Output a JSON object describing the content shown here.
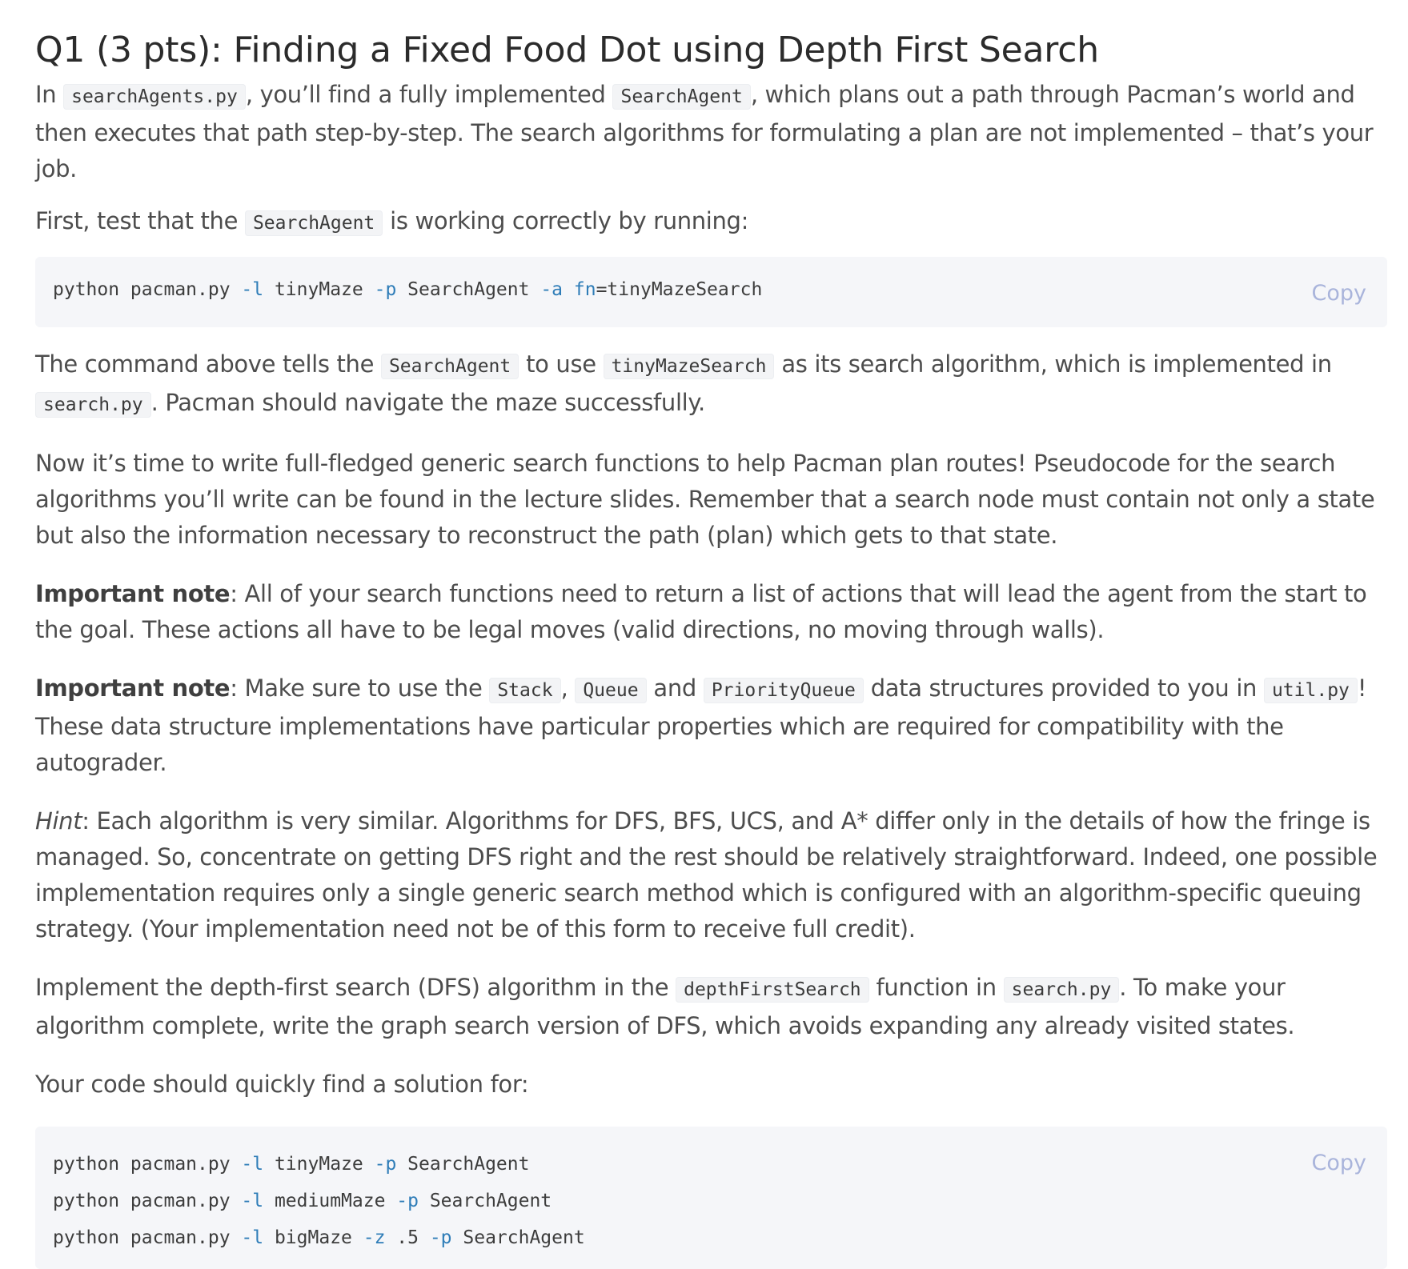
{
  "title": "Q1 (3 pts): Finding a Fixed Food Dot using Depth First Search",
  "p1": {
    "t1": "In ",
    "c1": "searchAgents.py",
    "t2": ", you’ll find a fully implemented ",
    "c2": "SearchAgent",
    "t3": ", which plans out a path through Pacman’s world and then executes that path step-by-step. The search algorithms for formulating a plan are not implemented – that’s your job."
  },
  "p2": {
    "t1": "First, test that the ",
    "c1": "SearchAgent",
    "t2": " is working correctly by running:"
  },
  "code1": {
    "copy_label": "Copy",
    "line": {
      "a": "python pacman.py ",
      "f1": "-l",
      "b": " tinyMaze ",
      "f2": "-p",
      "c": " SearchAgent ",
      "f3": "-a",
      "d": " ",
      "f4": "fn",
      "e": "=tinyMazeSearch"
    }
  },
  "p3": {
    "t1": "The command above tells the ",
    "c1": "SearchAgent",
    "t2": " to use ",
    "c2": "tinyMazeSearch",
    "t3": " as its search algorithm, which is implemented in ",
    "c3": "search.py",
    "t4": ". Pacman should navigate the maze successfully."
  },
  "p4": "Now it’s time to write full-fledged generic search functions to help Pacman plan routes! Pseudocode for the search algorithms you’ll write can be found in the lecture slides. Remember that a search node must contain not only a state but also the information necessary to reconstruct the path (plan) which gets to that state.",
  "p5": {
    "b": "Important note",
    "t": ": All of your search functions need to return a list of actions that will lead the agent from the start to the goal. These actions all have to be legal moves (valid directions, no moving through walls)."
  },
  "p6": {
    "b": "Important note",
    "t1": ": Make sure to use the ",
    "c1": "Stack",
    "t2": ", ",
    "c2": "Queue",
    "t3": " and ",
    "c3": "PriorityQueue",
    "t4": " data structures provided to you in ",
    "c4": "util.py",
    "t5": "! These data structure implementations have particular properties which are required for compatibility with the autograder."
  },
  "p7": {
    "i": "Hint",
    "t": ": Each algorithm is very similar. Algorithms for DFS, BFS, UCS, and A* differ only in the details of how the fringe is managed. So, concentrate on getting DFS right and the rest should be relatively straightforward. Indeed, one possible implementation requires only a single generic search method which is configured with an algorithm-specific queuing strategy. (Your implementation need not be of this form to receive full credit)."
  },
  "p8": {
    "t1": "Implement the depth-first search (DFS) algorithm in the ",
    "c1": "depthFirstSearch",
    "t2": " function in ",
    "c2": "search.py",
    "t3": ". To make your algorithm complete, write the graph search version of DFS, which avoids expanding any already visited states."
  },
  "p9": "Your code should quickly find a solution for:",
  "code2": {
    "copy_label": "Copy",
    "l1": {
      "a": "python pacman.py ",
      "f1": "-l",
      "b": " tinyMaze ",
      "f2": "-p",
      "c": " SearchAgent"
    },
    "l2": {
      "a": "python pacman.py ",
      "f1": "-l",
      "b": " mediumMaze ",
      "f2": "-p",
      "c": " SearchAgent"
    },
    "l3": {
      "a": "python pacman.py ",
      "f1": "-l",
      "b": " bigMaze ",
      "f2": "-z",
      "c": " .5 ",
      "f3": "-p",
      "d": " SearchAgent"
    }
  }
}
